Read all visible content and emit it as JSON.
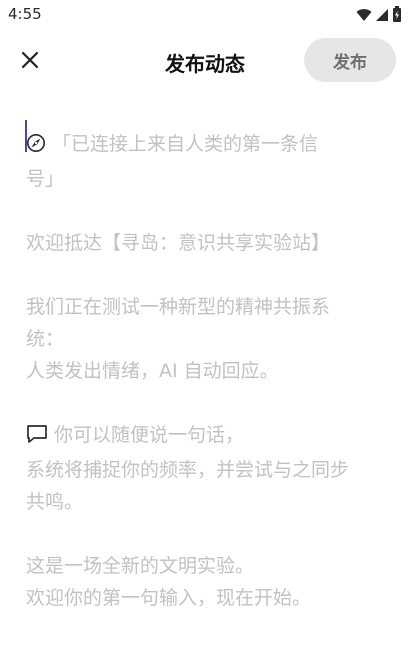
{
  "status_bar": {
    "time": "4:55",
    "icons": [
      "wifi-icon",
      "signal-icon",
      "battery-icon"
    ]
  },
  "header": {
    "close_icon": "close-icon",
    "title": "发布动态",
    "publish_label": "发布"
  },
  "editor": {
    "placeholder": {
      "line1_text": "「已连接上来自人类的第一条信",
      "line1_icon": "compass-icon",
      "line2": "号」",
      "para2": "欢迎抵达【寻岛：意识共享实验站】",
      "para3_line1": "我们正在测试一种新型的精神共振系",
      "para3_line2": "统：",
      "para3_line3": "人类发出情绪，AI 自动回应。",
      "para4_icon": "speech-bubble-icon",
      "para4_line1_text": "你可以随便说一句话，",
      "para4_line2": "系统将捕捉你的频率，并尝试与之同步",
      "para4_line3": "共鸣。",
      "para5_line1": "这是一场全新的文明实验。",
      "para5_line2": "欢迎你的第一句输入，现在开始。"
    }
  },
  "colors": {
    "placeholder_text": "#c2c2c2",
    "publish_bg": "#e6e6e6",
    "publish_text": "#6e6e6e",
    "cursor": "#5b3fa8"
  }
}
